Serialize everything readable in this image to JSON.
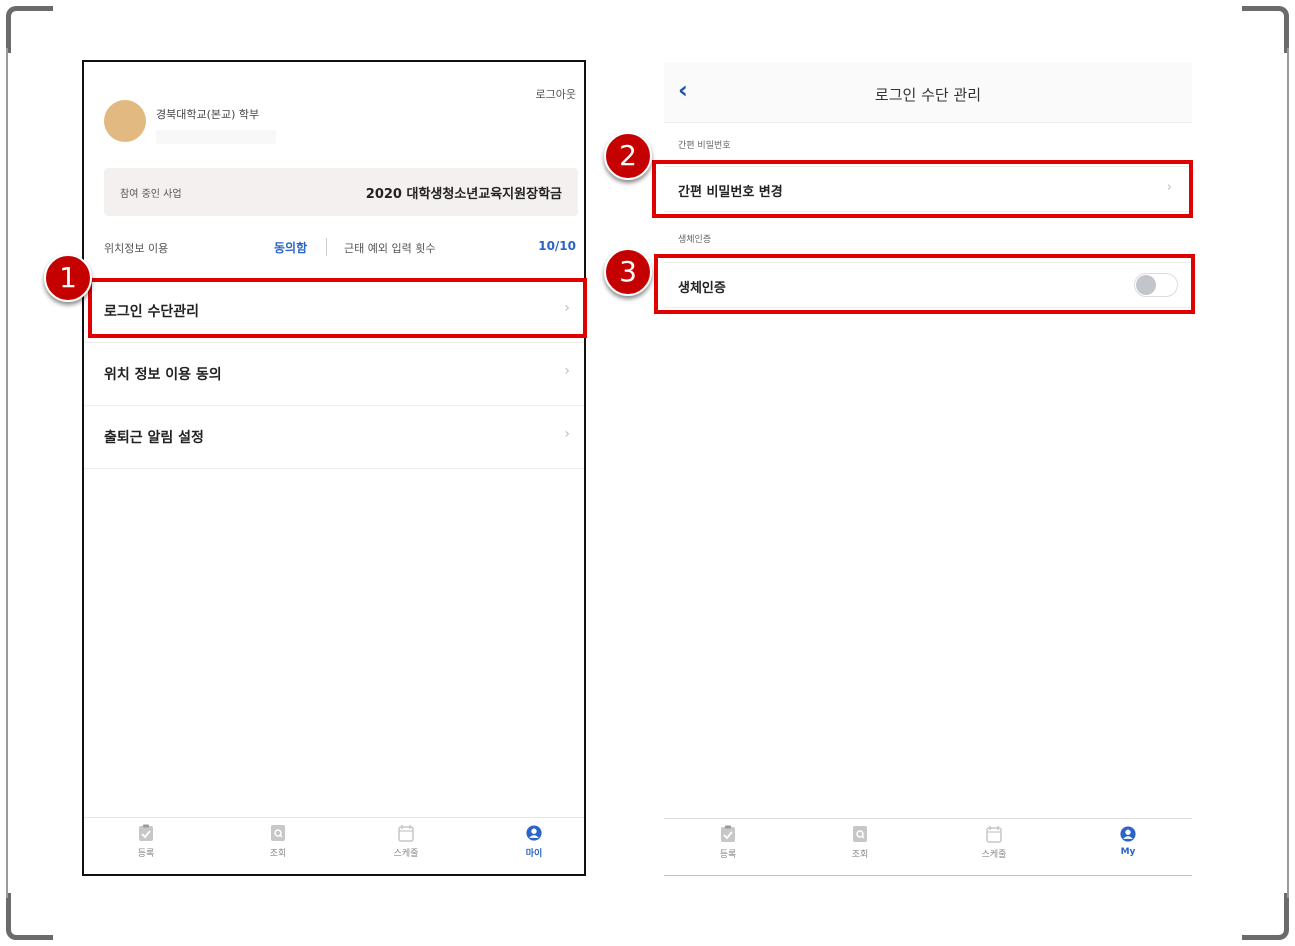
{
  "left_screen": {
    "logout": "로그아웃",
    "school": "경북대학교(본교) 학부",
    "business": {
      "label": "참여 중인 사업",
      "value": "2020 대학생청소년교육지원장학금"
    },
    "location": {
      "label": "위치정보 이용",
      "value": "동의함"
    },
    "attendance": {
      "label": "근태 예외 입력 횟수",
      "value": "10/10"
    },
    "menu": [
      {
        "label": "로그인 수단관리"
      },
      {
        "label": "위치 정보 이용 동의"
      },
      {
        "label": "출퇴근 알림 설정"
      }
    ],
    "tabs": [
      {
        "label": "등록",
        "icon": "clipboard-check-icon"
      },
      {
        "label": "조회",
        "icon": "document-search-icon"
      },
      {
        "label": "스케줄",
        "icon": "calendar-icon"
      },
      {
        "label": "마이",
        "icon": "user-circle-icon"
      }
    ]
  },
  "right_screen": {
    "title": "로그인 수단 관리",
    "section_password": "간편 비밀번호",
    "change_password": "간편 비밀번호 변경",
    "section_bio": "생체인증",
    "biometric_label": "생체인증",
    "biometric_enabled": false,
    "tabs": [
      {
        "label": "등록",
        "icon": "clipboard-check-icon"
      },
      {
        "label": "조회",
        "icon": "document-search-icon"
      },
      {
        "label": "스케줄",
        "icon": "calendar-icon"
      },
      {
        "label": "My",
        "icon": "user-circle-icon"
      }
    ]
  },
  "badges": [
    "1",
    "2",
    "3"
  ],
  "colors": {
    "highlight": "#e00000",
    "badge": "#c40000",
    "accent": "#2b64c8"
  }
}
